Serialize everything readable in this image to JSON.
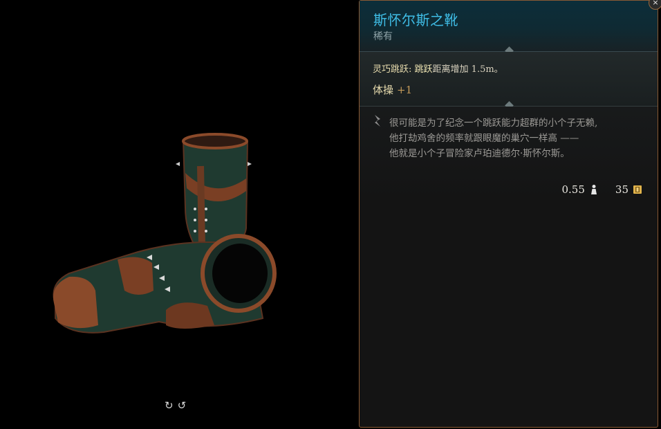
{
  "item": {
    "name": "斯怀尔斯之靴",
    "rarity": "稀有"
  },
  "effect": {
    "name": "灵巧跳跃:",
    "keyword": "跳跃",
    "text": "距离增加 1.5m。"
  },
  "stat": {
    "name": "体操",
    "bonus": "+1"
  },
  "lore": {
    "line1": "很可能是为了纪念一个跳跃能力超群的小个子无赖,",
    "line2": "他打劫鸡舍的频率就跟眼魔的巢穴一样高 ——",
    "line3": "他就是小个子冒险家卢珀迪德尔·斯怀尔斯。"
  },
  "weight": {
    "value": "0.55",
    "icon": "weight-icon"
  },
  "price": {
    "value": "35",
    "icon": "gold-coin-icon"
  },
  "controls": {
    "rotate_left": "↻",
    "rotate_right": "↺",
    "close": "×"
  },
  "colors": {
    "item_name": "#3fbde6",
    "border": "#8a5a34",
    "panel_bg": "#141414"
  }
}
